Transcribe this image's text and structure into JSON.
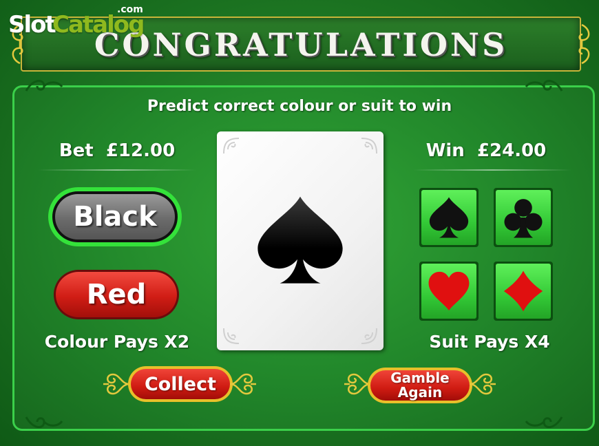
{
  "watermark": {
    "part1": "Slot",
    "part2": "Catalog",
    "suffix": ".com"
  },
  "title": "CONGRATULATIONS",
  "instruction": "Predict correct colour or suit to win",
  "bet": {
    "label": "Bet",
    "value": "£12.00"
  },
  "win": {
    "label": "Win",
    "value": "£24.00"
  },
  "colour_buttons": {
    "black": "Black",
    "red": "Red"
  },
  "colour_pays": "Colour Pays X2",
  "suit_pays": "Suit Pays X4",
  "revealed_card": {
    "suit": "spades",
    "icon": "spade-icon",
    "color": "#000000"
  },
  "suit_buttons": [
    {
      "name": "spades",
      "icon": "spade-icon",
      "color": "#111111"
    },
    {
      "name": "clubs",
      "icon": "club-icon",
      "color": "#111111"
    },
    {
      "name": "hearts",
      "icon": "heart-icon",
      "color": "#e01010"
    },
    {
      "name": "diamonds",
      "icon": "diamond-icon",
      "color": "#e01010"
    }
  ],
  "actions": {
    "collect": "Collect",
    "gamble_line1": "Gamble",
    "gamble_line2": "Again"
  },
  "colors": {
    "felt": "#21862a",
    "border": "#3bd04a",
    "gold": "#e8c02a",
    "red_button": "#d01d15",
    "selected_outline": "#34e23a"
  }
}
